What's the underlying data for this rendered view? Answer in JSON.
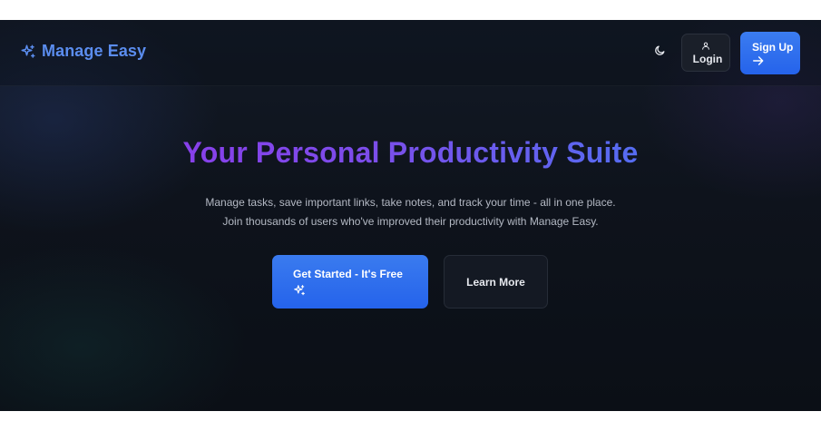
{
  "navbar": {
    "brand": {
      "name": "Manage Easy",
      "icon": "sparkles-icon"
    },
    "theme_toggle": {
      "icon": "moon-icon"
    },
    "login": {
      "label": "Login",
      "icon": "user-icon"
    },
    "signup": {
      "label": "Sign Up",
      "icon": "arrow-right-icon"
    }
  },
  "hero": {
    "title": "Your Personal Productivity Suite",
    "subtitle_line1": "Manage tasks, save important links, take notes, and track your time - all in one place.",
    "subtitle_line2": "Join thousands of users who've improved their productivity with Manage Easy.",
    "primary_cta": {
      "label": "Get Started - It's Free",
      "icon": "sparkles-icon"
    },
    "secondary_cta": {
      "label": "Learn More"
    }
  },
  "colors": {
    "brand": "#5b8def",
    "primary_button": "#2563eb",
    "title_gradient_start": "#9333ea",
    "title_gradient_end": "#3b82f6",
    "background": "#0e131c"
  }
}
